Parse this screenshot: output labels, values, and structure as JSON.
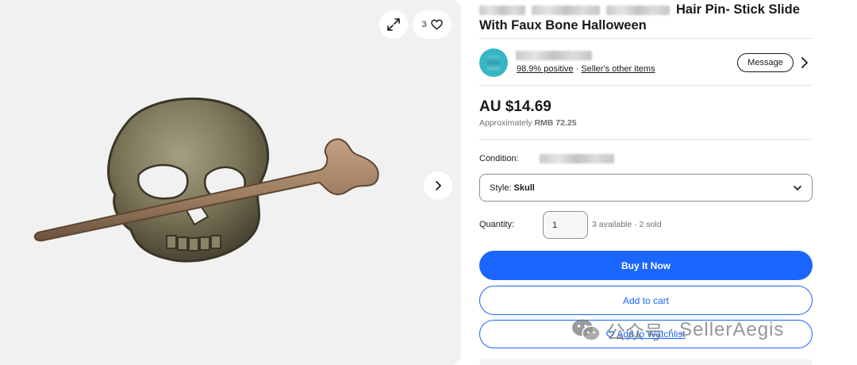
{
  "gallery": {
    "watch_count": "3",
    "icons": [
      "expand-icon",
      "heart-icon",
      "chevron-right-icon"
    ]
  },
  "listing": {
    "title_visible": "Hair Pin- Stick Slide With Faux Bone Halloween"
  },
  "seller": {
    "feedback": "98.9% positive",
    "separator": "·",
    "other_items": "Seller's other items",
    "message_label": "Message"
  },
  "price": {
    "main": "AU $14.69",
    "approx_prefix": "Approximately",
    "approx_value": "RMB 72.25"
  },
  "condition": {
    "label": "Condition:"
  },
  "style": {
    "label": "Style:",
    "value": "Skull"
  },
  "quantity": {
    "label": "Quantity:",
    "value": "1",
    "availability": "3 available · 2 sold"
  },
  "actions": {
    "buy_now": "Buy It Now",
    "add_to_cart": "Add to cart",
    "add_to_watchlist": "Add to Watchlist"
  },
  "watermark": {
    "text_cn": "公众号",
    "dot": "·",
    "text": "SellerAegis"
  },
  "colors": {
    "accent": "#1a66ff",
    "gallery_bg": "#f1f1f1",
    "avatar": "#36b6c4"
  }
}
